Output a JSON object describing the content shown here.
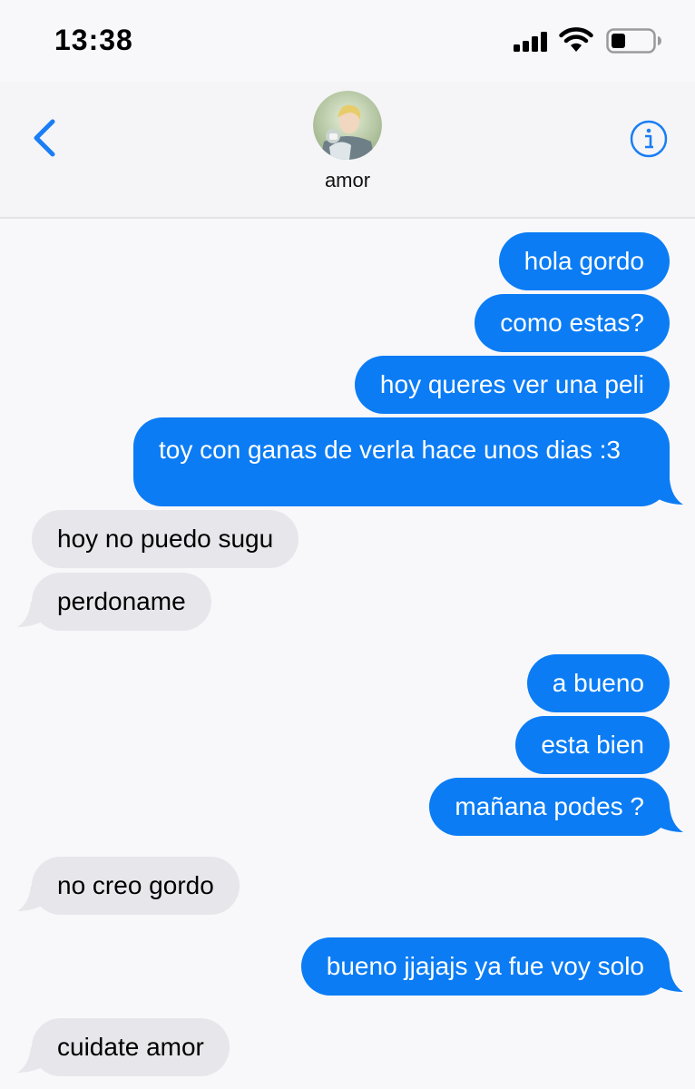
{
  "status_bar": {
    "time": "13:38",
    "icons": [
      "signal-bars-icon",
      "wifi-icon",
      "battery-icon"
    ],
    "battery_level": 0.35
  },
  "header": {
    "contact_name": "amor",
    "back_icon": "chevron-left-icon",
    "info_icon": "info-circle-icon"
  },
  "colors": {
    "outgoing_bubble": "#0b7cf4",
    "incoming_bubble": "#e7e6eb",
    "accent": "#1a7ef5"
  },
  "messages": [
    {
      "direction": "outgoing",
      "text": "hola gordo"
    },
    {
      "direction": "outgoing",
      "text": "como estas?"
    },
    {
      "direction": "outgoing",
      "text": "hoy queres ver una peli"
    },
    {
      "direction": "outgoing",
      "text": "toy con ganas de verla hace unos dias :3"
    },
    {
      "direction": "incoming",
      "text": "hoy no puedo sugu"
    },
    {
      "direction": "incoming",
      "text": "perdoname"
    },
    {
      "direction": "outgoing",
      "text": "a bueno"
    },
    {
      "direction": "outgoing",
      "text": "esta bien"
    },
    {
      "direction": "outgoing",
      "text": "mañana podes ?"
    },
    {
      "direction": "incoming",
      "text": "no creo gordo"
    },
    {
      "direction": "outgoing",
      "text": "bueno jjajajs ya fue voy solo"
    },
    {
      "direction": "incoming",
      "text": "cuidate amor"
    }
  ]
}
